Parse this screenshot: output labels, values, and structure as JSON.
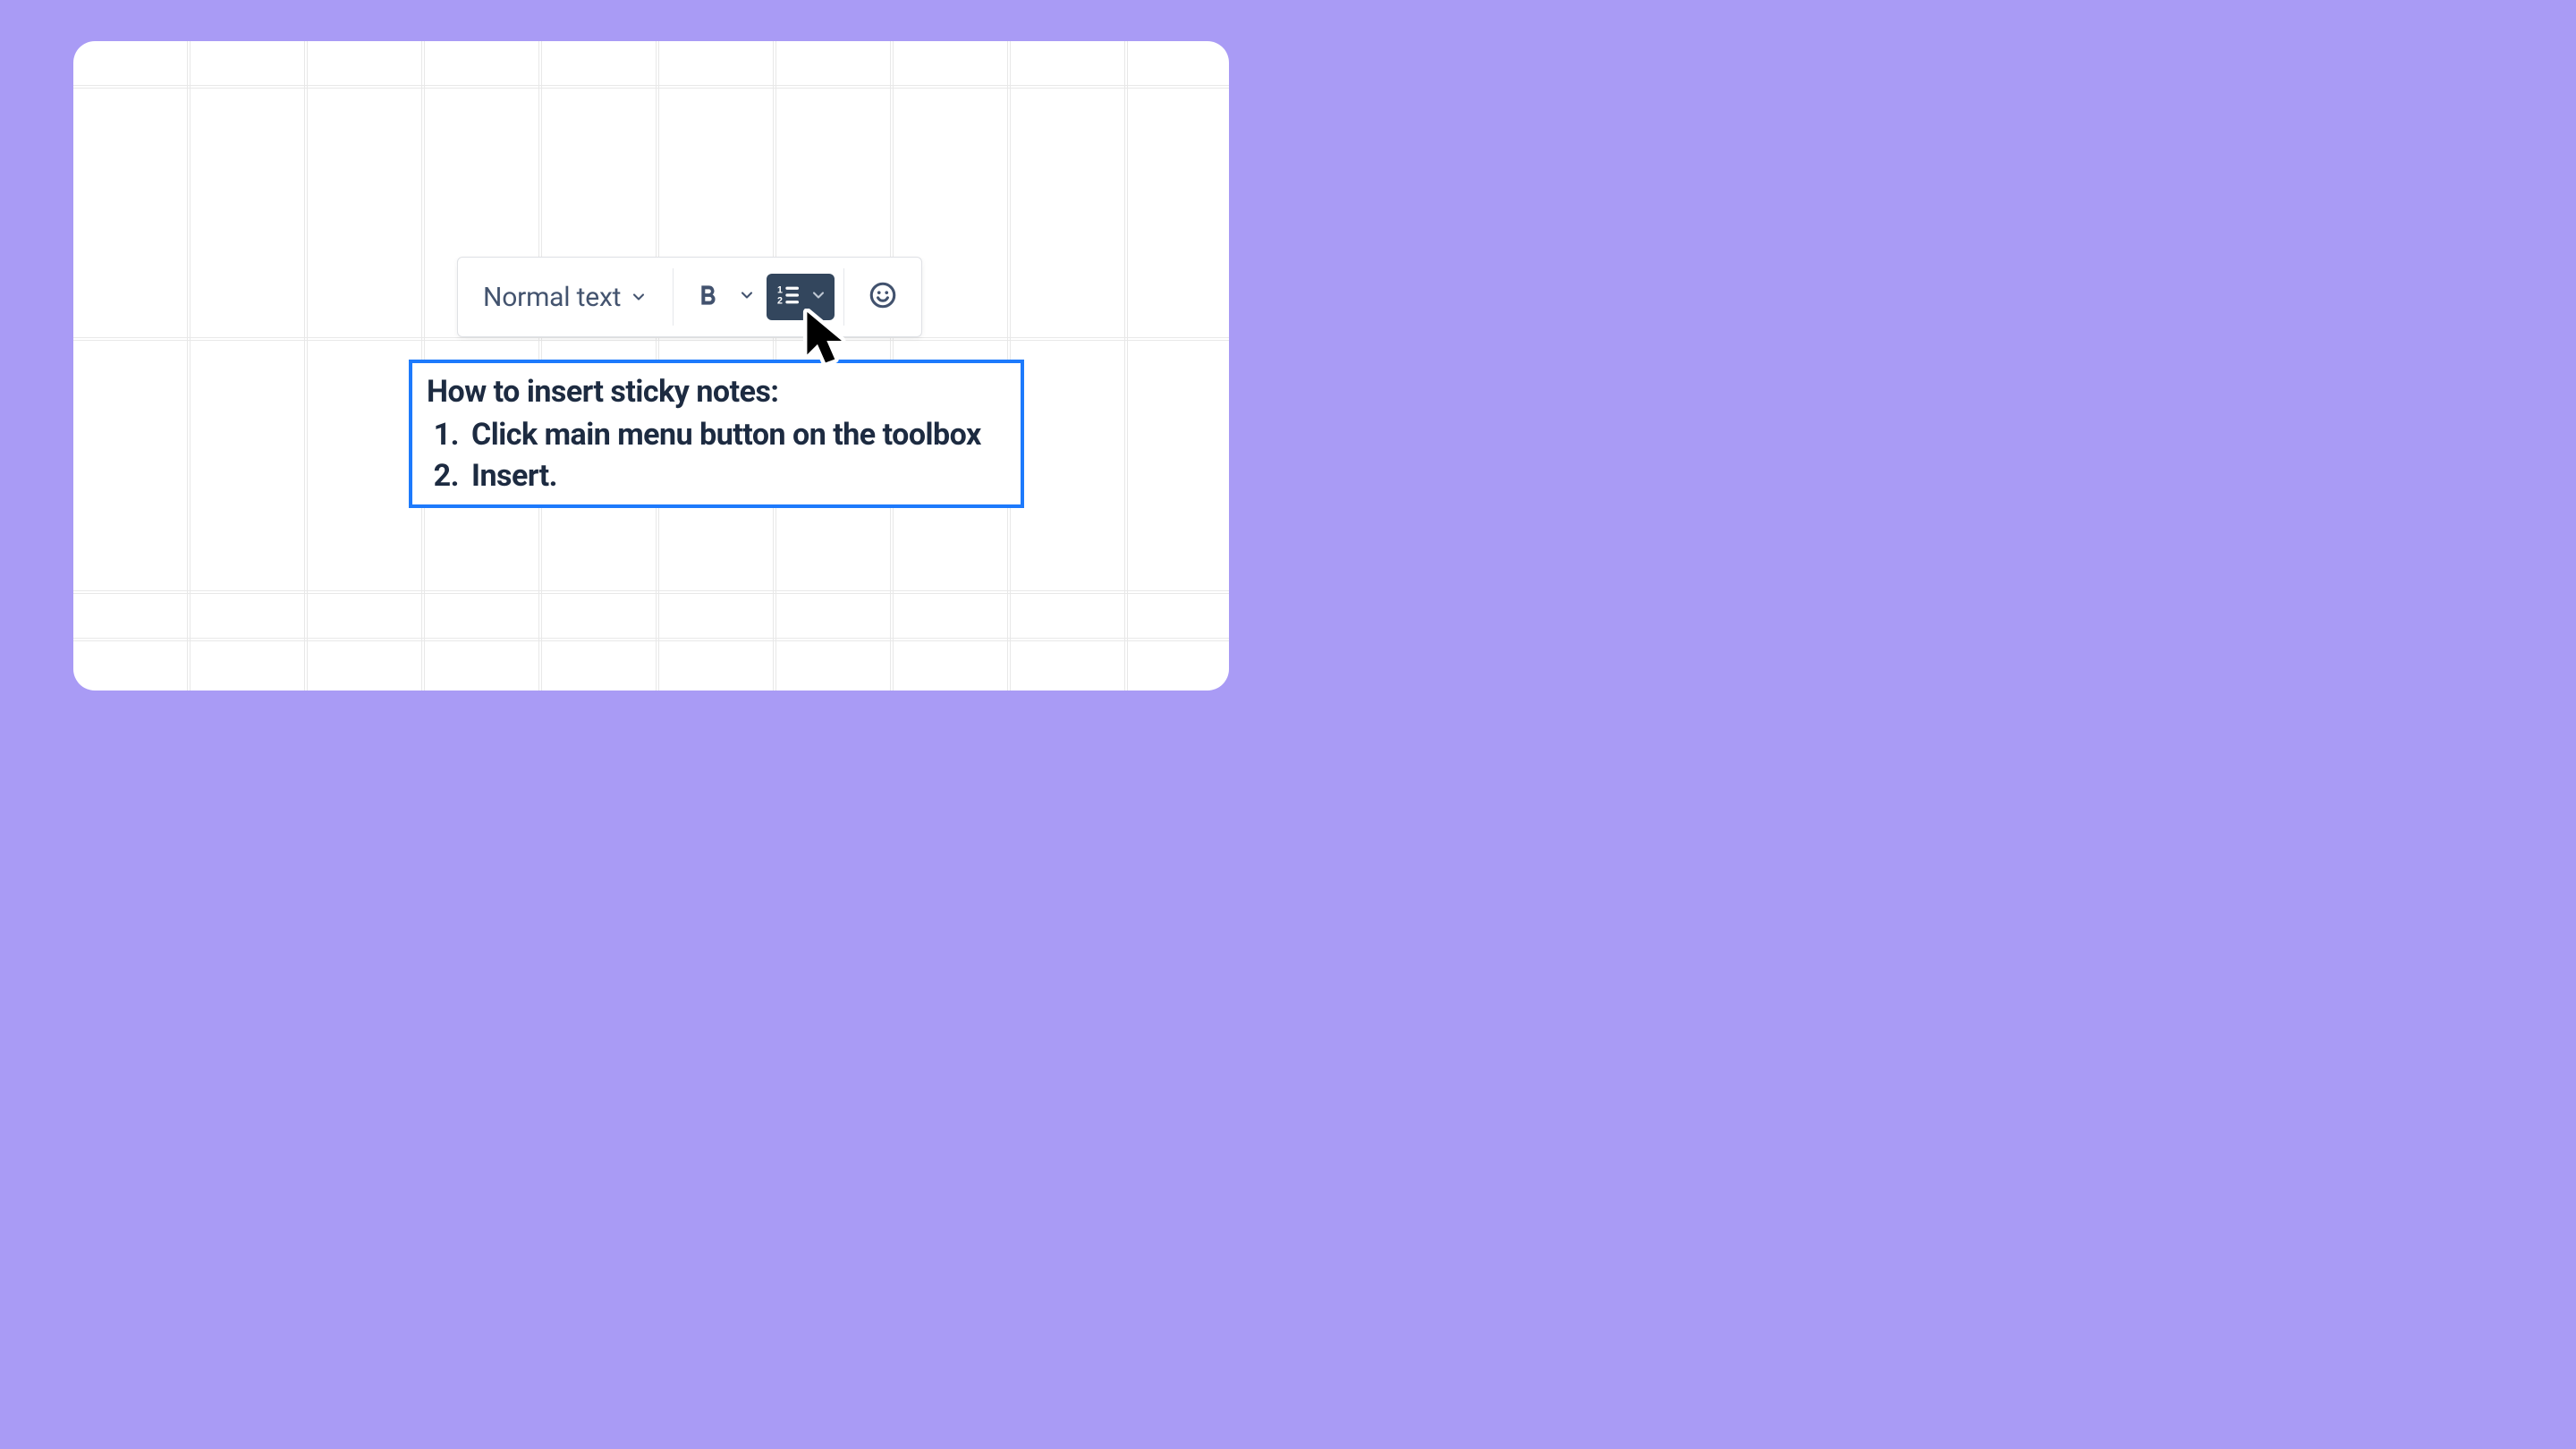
{
  "colors": {
    "page_bg": "#A99BF5",
    "panel_bg": "#FFFFFF",
    "grid_line": "#E6E6E6",
    "toolbar_border": "#DFE1E5",
    "muted_text": "#44546F",
    "icon_color": "#42526E",
    "active_bg": "#33465D",
    "selection_border": "#1D7AFC",
    "content_text": "#1D2B41"
  },
  "toolbar": {
    "text_style_label": "Normal text",
    "bold_icon": "bold",
    "list_icon": "numbered-list",
    "emoji_icon": "smiley",
    "active_button": "list"
  },
  "text_block": {
    "heading": "How to insert sticky notes:",
    "list_items": [
      "Click main menu button on the toolbox",
      "Insert."
    ]
  }
}
